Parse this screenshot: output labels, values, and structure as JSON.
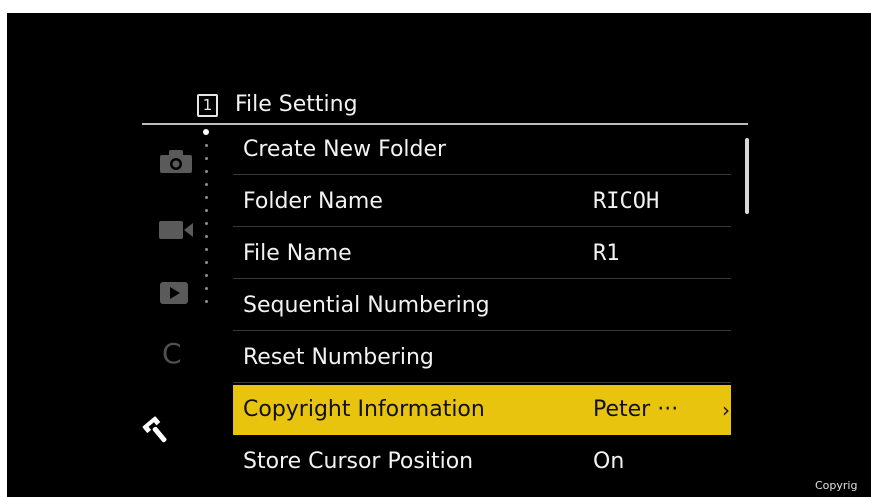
{
  "header": {
    "page_number": "1",
    "title": "File Setting"
  },
  "side_tabs": [
    "camera-icon",
    "movie-icon",
    "play-icon",
    "custom-mode-icon",
    "wrench-icon"
  ],
  "custom_tab_glyph": "C",
  "menu": {
    "items": [
      {
        "label": "Create New Folder",
        "value": ""
      },
      {
        "label": "Folder Name",
        "value": "RICOH"
      },
      {
        "label": "File Name",
        "value": "R1"
      },
      {
        "label": "Sequential Numbering",
        "value": ""
      },
      {
        "label": "Reset Numbering",
        "value": ""
      },
      {
        "label": "Copyright Information",
        "value": "Peter ···",
        "chevron": "›",
        "selected": true
      },
      {
        "label": "Store Cursor Position",
        "value": "On"
      }
    ]
  },
  "watermark": "Copyrig",
  "colors": {
    "highlight": "#e8c40e",
    "background": "#000000",
    "text": "#f2f2f2"
  }
}
